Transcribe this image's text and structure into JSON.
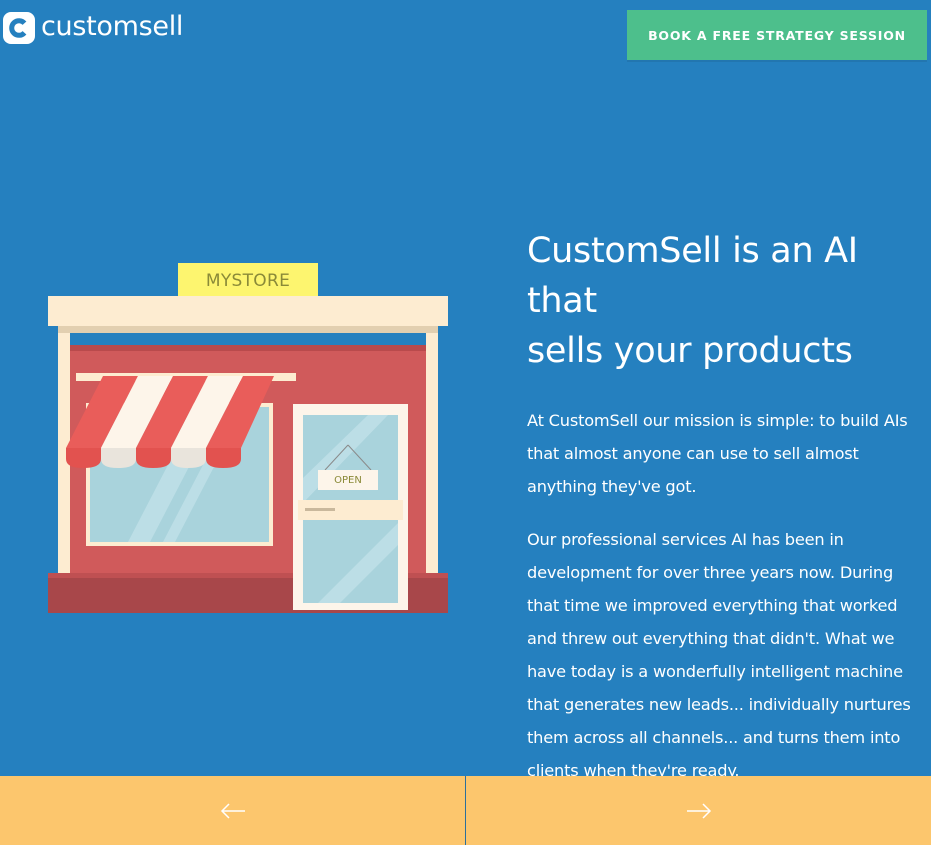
{
  "header": {
    "logo_text": "customsell",
    "logo_icon": "customsell-c-logo",
    "cta_label": "BOOK A FREE STRATEGY SESSION"
  },
  "illustration": {
    "sign_text": "MYSTORE",
    "door_sign": "OPEN"
  },
  "hero": {
    "headline_lines": [
      "CustomSell is an AI",
      "that",
      "sells your products"
    ],
    "paragraph_1": "At CustomSell our mission is simple: to build AIs that almost anyone can use to sell almost anything they've got.",
    "paragraph_2": "Our professional services AI has been in development for over three years now. During that time we improved everything that worked and threw out everything that didn't. What we have today is a wonderfully intelligent machine that generates new leads... individually nurtures them across all channels... and turns them into clients when they're ready."
  },
  "navigation": {
    "prev_icon": "arrow-left-icon",
    "next_icon": "arrow-right-icon"
  },
  "colors": {
    "background": "#2580bf",
    "cta": "#4dbf8c",
    "nav_bar": "#fcc66d",
    "store_wall": "#d05a5b",
    "sign": "#fdf56f"
  }
}
